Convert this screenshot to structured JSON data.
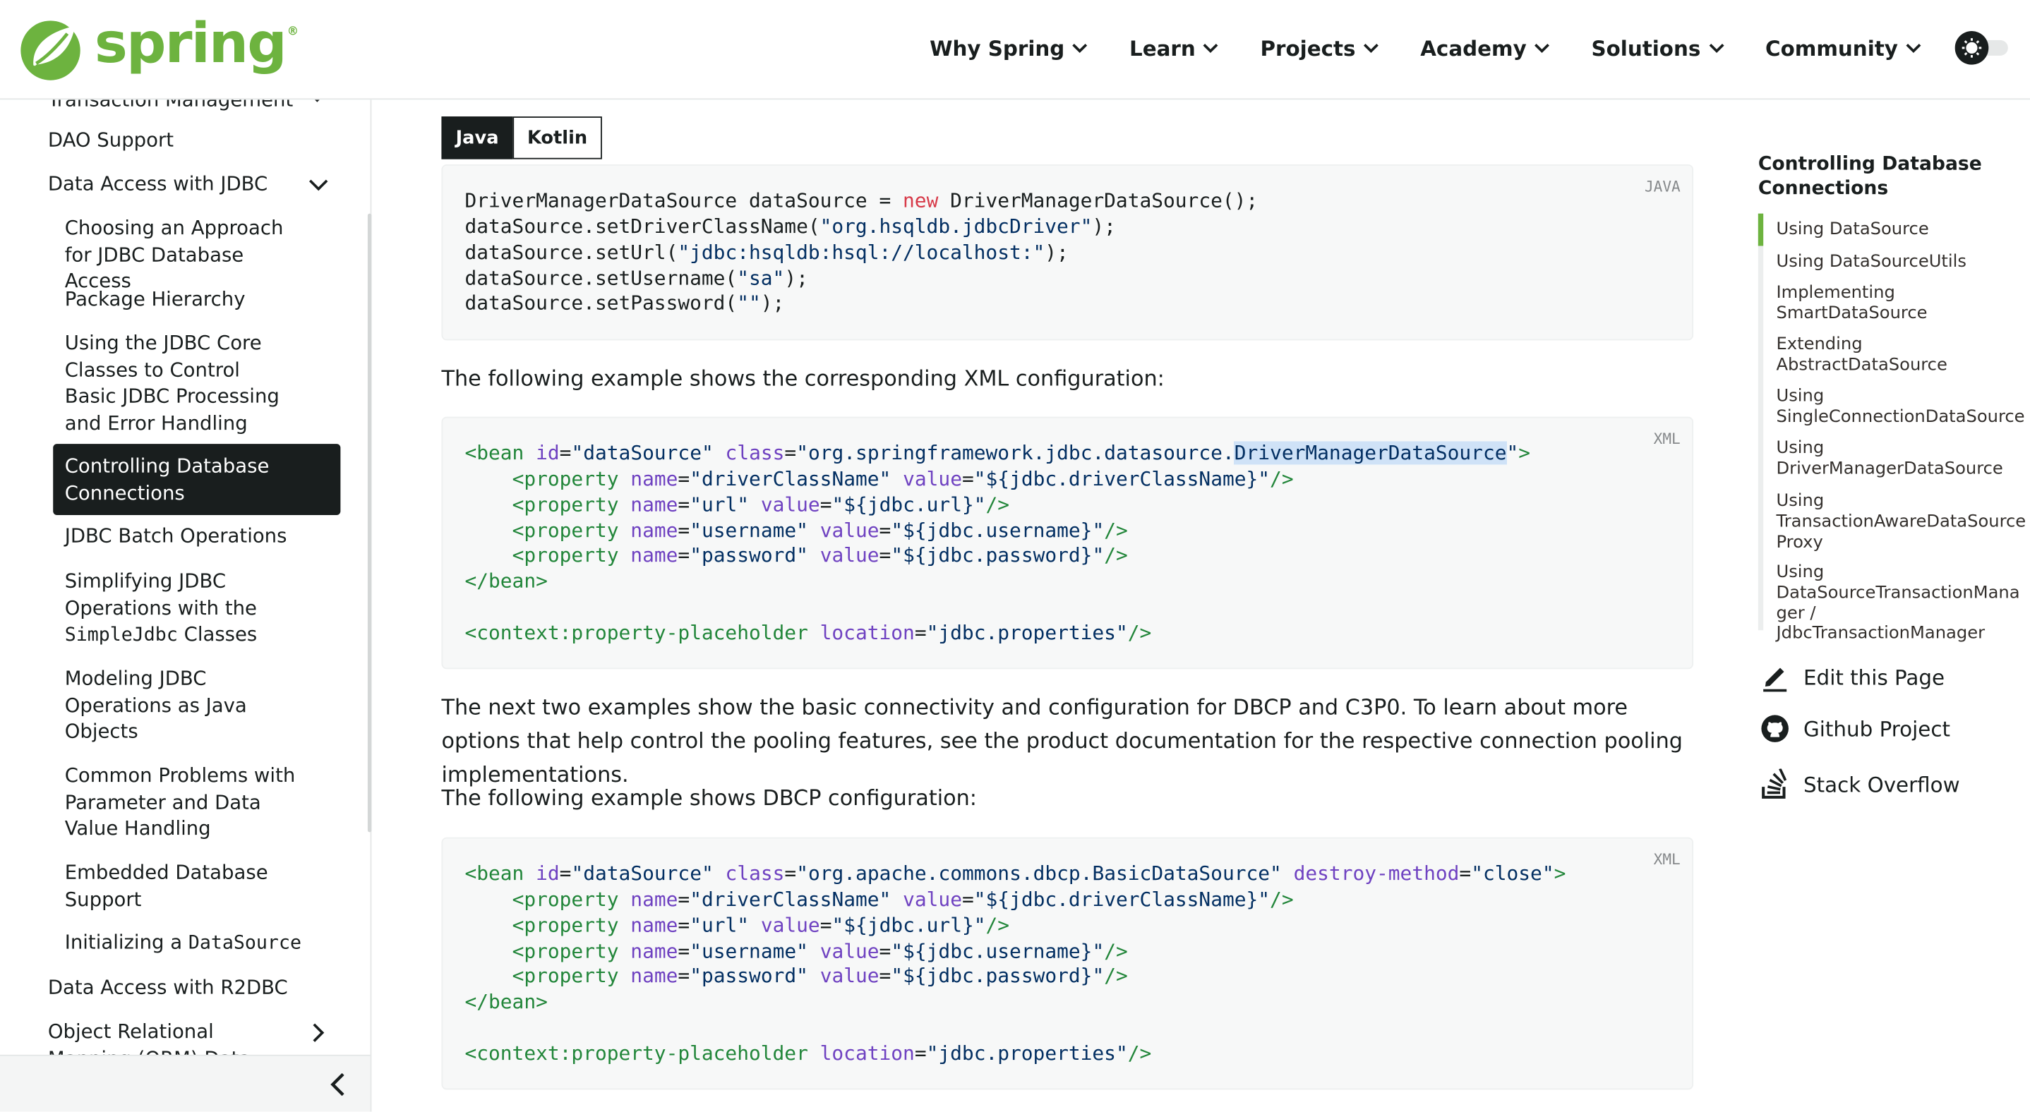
{
  "header": {
    "logo_text": "spring",
    "logo_mark": "®",
    "nav": [
      "Why Spring",
      "Learn",
      "Projects",
      "Academy",
      "Solutions",
      "Community"
    ]
  },
  "sidebar": {
    "items": [
      {
        "label": "Transaction Management",
        "level": 1
      },
      {
        "label": "DAO Support",
        "level": 1
      },
      {
        "label": "Data Access with JDBC",
        "level": 1,
        "expanded": true
      },
      {
        "label": "Choosing an Approach for JDBC Database Access",
        "level": 2
      },
      {
        "label": "Package Hierarchy",
        "level": 2
      },
      {
        "label": "Using the JDBC Core Classes to Control Basic JDBC Processing and Error Handling",
        "level": 2
      },
      {
        "label": "Controlling Database Connections",
        "level": 2,
        "active": true
      },
      {
        "label": "JDBC Batch Operations",
        "level": 2
      },
      {
        "label_prefix": "Simplifying JDBC Operations with the",
        "label_code": "SimpleJdbc",
        "label_suffix": "Classes",
        "level": 2
      },
      {
        "label": "Modeling JDBC Operations as Java Objects",
        "level": 2
      },
      {
        "label": "Common Problems with Parameter and Data Value Handling",
        "level": 2
      },
      {
        "label": "Embedded Database Support",
        "level": 2
      },
      {
        "label_prefix": "Initializing a",
        "label_code": "DataSource",
        "level": 2
      },
      {
        "label": "Data Access with R2DBC",
        "level": 1
      },
      {
        "label": "Object Relational Mapping (ORM) Data Access",
        "level": 1
      }
    ]
  },
  "tabs": {
    "java": "Java",
    "kotlin": "Kotlin"
  },
  "code1": {
    "lang": "JAVA",
    "l1a": "DriverManagerDataSource dataSource = ",
    "l1kw": "new",
    "l1b": " DriverManagerDataSource();",
    "l2a": "dataSource.setDriverClassName(",
    "l2s": "\"org.hsqldb.jdbcDriver\"",
    "l2b": ");",
    "l3a": "dataSource.setUrl(",
    "l3s": "\"jdbc:hsqldb:hsql://localhost:\"",
    "l3b": ");",
    "l4a": "dataSource.setUsername(",
    "l4s": "\"sa\"",
    "l4b": ");",
    "l5a": "dataSource.setPassword(",
    "l5s": "\"\"",
    "l5b": ");"
  },
  "para1": "The following example shows the corresponding XML configuration:",
  "code2": {
    "lang": "XML",
    "bean_open": "<bean",
    "id_attr": "id",
    "id_val": "\"dataSource\"",
    "class_attr": "class",
    "class_val_a": "\"org.springframework.jdbc.datasource.",
    "class_val_hl": "DriverManagerDataSource",
    "class_val_b": "\"",
    "gt": ">",
    "prop": "<property",
    "name_attr": "name",
    "value_attr": "value",
    "p1n": "\"driverClassName\"",
    "p1v": "\"${jdbc.driverClassName}\"",
    "p2n": "\"url\"",
    "p2v": "\"${jdbc.url}\"",
    "p3n": "\"username\"",
    "p3v": "\"${jdbc.username}\"",
    "p4n": "\"password\"",
    "p4v": "\"${jdbc.password}\"",
    "selfclose": "/>",
    "bean_close": "</bean>",
    "ctx": "<context:property-placeholder",
    "loc_attr": "location",
    "loc_val": "\"jdbc.properties\""
  },
  "para2": "The next two examples show the basic connectivity and configuration for DBCP and C3P0. To learn about more options that help control the pooling features, see the product documentation for the respective connection pooling implementations.",
  "para3": "The following example shows DBCP configuration:",
  "code3": {
    "lang": "XML",
    "class_val": "\"org.apache.commons.dbcp.BasicDataSource\"",
    "destroy_attr": "destroy-method",
    "destroy_val": "\"close\""
  },
  "toc": {
    "title": "Controlling Database Connections",
    "items": [
      "Using DataSource",
      "Using DataSourceUtils",
      "Implementing SmartDataSource",
      "Extending AbstractDataSource",
      "Using SingleConnectionDataSource",
      "Using DriverManagerDataSource",
      "Using TransactionAwareDataSource Proxy",
      "Using DataSourceTransactionMana ger / JdbcTransactionManager"
    ],
    "active_index": 0
  },
  "links": {
    "edit": "Edit this Page",
    "github": "Github Project",
    "stack": "Stack Overflow"
  },
  "colors": {
    "brand": "#6db33f",
    "dark": "#191e1e",
    "code_bg": "#f7f8f8"
  }
}
